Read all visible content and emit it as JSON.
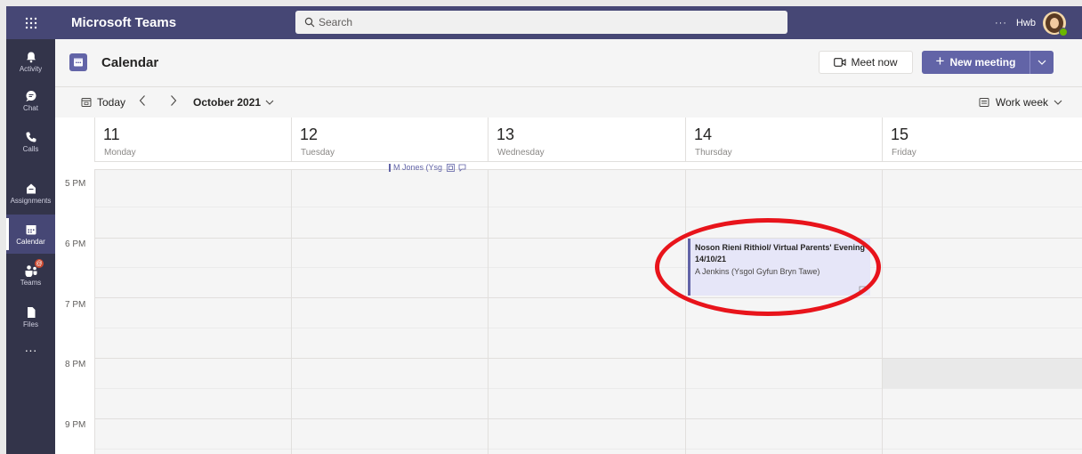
{
  "app": {
    "title": "Microsoft Teams"
  },
  "search": {
    "placeholder": "Search"
  },
  "user": {
    "more": "···",
    "name": "Hwb"
  },
  "rail": {
    "items": [
      {
        "label": "Activity",
        "icon": "bell-icon"
      },
      {
        "label": "Chat",
        "icon": "chat-icon"
      },
      {
        "label": "Calls",
        "icon": "phone-icon"
      },
      {
        "label": "Assignments",
        "icon": "assignments-icon"
      },
      {
        "label": "Calendar",
        "icon": "calendar-icon",
        "active": true
      },
      {
        "label": "Teams",
        "icon": "teams-icon"
      },
      {
        "label": "Files",
        "icon": "file-icon"
      }
    ],
    "more": "···"
  },
  "header": {
    "title": "Calendar",
    "meet_now": "Meet now",
    "new_meeting": "New meeting"
  },
  "nav": {
    "today": "Today",
    "month": "October 2021",
    "view": "Work week"
  },
  "days": [
    {
      "num": "11",
      "name": "Monday"
    },
    {
      "num": "12",
      "name": "Tuesday"
    },
    {
      "num": "13",
      "name": "Wednesday"
    },
    {
      "num": "14",
      "name": "Thursday"
    },
    {
      "num": "15",
      "name": "Friday"
    }
  ],
  "times": [
    "5 PM",
    "6 PM",
    "7 PM",
    "8 PM",
    "9 PM"
  ],
  "events": {
    "mini": {
      "text": "M Jones (Ysg"
    },
    "main": {
      "title": "Noson Rieni Rithiol/ Virtual Parents' Evening 14/10/21",
      "organizer": "A Jenkins (Ysgol Gyfun Bryn Tawe)"
    }
  },
  "colors": {
    "topbar": "#464775",
    "rail": "#33344a",
    "accent": "#6264a7",
    "annotation": "#e8141b"
  }
}
